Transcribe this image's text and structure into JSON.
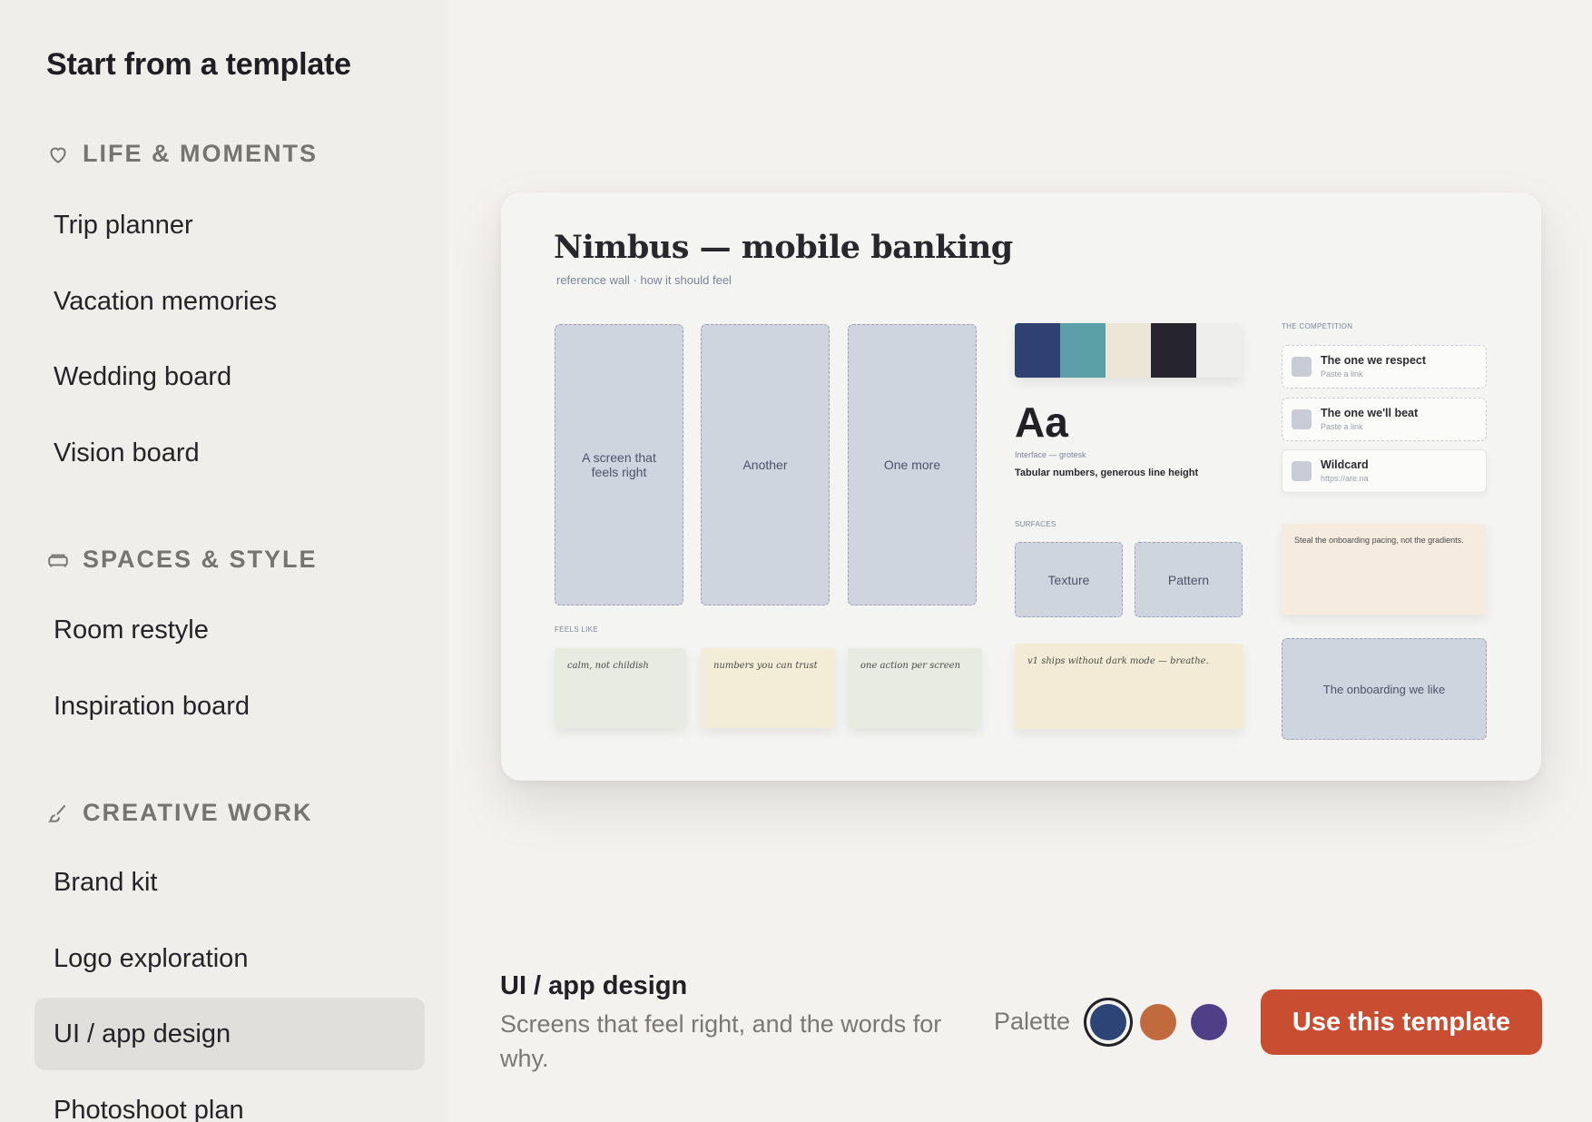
{
  "sidebar": {
    "title": "Start from a template",
    "sections": [
      {
        "label": "LIFE & MOMENTS",
        "icon": "heart-icon",
        "items": [
          "Trip planner",
          "Vacation memories",
          "Wedding board",
          "Vision board"
        ]
      },
      {
        "label": "SPACES & STYLE",
        "icon": "sofa-icon",
        "items": [
          "Room restyle",
          "Inspiration board"
        ]
      },
      {
        "label": "CREATIVE WORK",
        "icon": "brush-icon",
        "items": [
          "Brand kit",
          "Logo exploration",
          "UI / app design",
          "Photoshoot plan"
        ]
      }
    ],
    "selected_item": "UI / app design"
  },
  "preview": {
    "title": "Nimbus — mobile banking",
    "subtitle": "reference wall · how it should feel",
    "screens": [
      "A screen that feels right",
      "Another",
      "One more"
    ],
    "feels_like_label": "FEELS LIKE",
    "notes": [
      "calm, not childish",
      "numbers you can trust",
      "one action per screen",
      "v1 ships without dark mode — breathe."
    ],
    "swatches": [
      "#2f4170",
      "#5aa0a6",
      "#ece6d6",
      "#26252d",
      "#eeefed"
    ],
    "type_sample": "Aa",
    "type_caption": "Interface — grotesk",
    "type_note": "Tabular numbers, generous line height",
    "surfaces_label": "SURFACES",
    "surfaces": [
      "Texture",
      "Pattern"
    ],
    "competition_label": "THE COMPETITION",
    "competition": [
      {
        "title": "The one we respect",
        "sub": "Paste a link"
      },
      {
        "title": "The one we'll beat",
        "sub": "Paste a link"
      },
      {
        "title": "Wildcard",
        "sub": "https://are.na"
      }
    ],
    "sticky_note": "Steal the onboarding pacing, not the gradients.",
    "onboarding": "The onboarding we like"
  },
  "footer": {
    "template_title": "UI / app design",
    "template_desc": "Screens that feel right, and the words for why.",
    "palette_label": "Palette",
    "palette_colors": [
      "#2c4476",
      "#c06a3e",
      "#4e3f86"
    ],
    "selected_palette": 0,
    "use_button": "Use this template"
  },
  "colors": {
    "accent": "#c94e31",
    "sidebar_bg": "#efeeea",
    "selected_item_bg": "#e0dfdb"
  }
}
